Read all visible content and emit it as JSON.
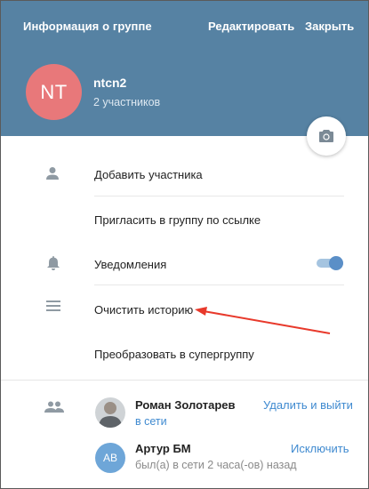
{
  "header": {
    "title": "Информация о группе",
    "edit_label": "Редактировать",
    "close_label": "Закрыть",
    "bg_color": "#5682a3"
  },
  "group": {
    "initials": "NT",
    "name": "ntcn2",
    "members_count": "2 участников",
    "avatar_color": "#e8787a"
  },
  "camera_button": {
    "icon": "camera-icon"
  },
  "actions": {
    "add_member": "Добавить участника",
    "invite_link": "Пригласить в группу по ссылке",
    "notifications": "Уведомления",
    "notifications_enabled": true,
    "clear_history": "Очистить историю",
    "convert_supergroup": "Преобразовать в супергруппу"
  },
  "members": [
    {
      "name": "Роман Золотарев",
      "status": "в сети",
      "status_color": "#3f8ad0",
      "action": "Удалить и выйти",
      "avatar": "photo"
    },
    {
      "name": "Артур БМ",
      "status": "был(а) в сети 2 часа(-ов) назад",
      "status_color": "#8a8a8a",
      "action": "Исключить",
      "initials": "АВ",
      "avatar_color": "#6ea6d8"
    }
  ],
  "annotation": {
    "arrow_color": "#e8392b"
  }
}
